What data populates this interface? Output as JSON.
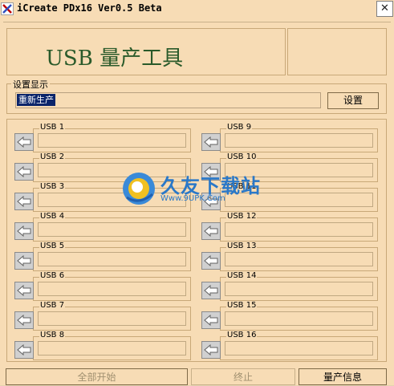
{
  "window": {
    "title": "iCreate PDx16 Ver0.5 Beta",
    "close_glyph": "✕"
  },
  "header": {
    "title": "USB 量产工具"
  },
  "settings": {
    "group_label": "设置显示",
    "value": "重新生产",
    "button_label": "设置"
  },
  "ports_left": [
    {
      "label": "USB 1"
    },
    {
      "label": "USB 2"
    },
    {
      "label": "USB 3"
    },
    {
      "label": "USB 4"
    },
    {
      "label": "USB 5"
    },
    {
      "label": "USB 6"
    },
    {
      "label": "USB 7"
    },
    {
      "label": "USB 8"
    }
  ],
  "ports_right": [
    {
      "label": "USB 9"
    },
    {
      "label": "USB 10"
    },
    {
      "label": "USB 11"
    },
    {
      "label": "USB 12"
    },
    {
      "label": "USB 13"
    },
    {
      "label": "USB 14"
    },
    {
      "label": "USB 15"
    },
    {
      "label": "USB 16"
    }
  ],
  "watermark": {
    "logo_text": "久友下载站",
    "url": "Www.9UPK.Com"
  },
  "footer": {
    "start_all": "全部开始",
    "stop": "终止",
    "info": "量产信息"
  },
  "colors": {
    "background": "#f7dcb5",
    "selection": "#0a246a",
    "header_text": "#2a5a2a",
    "watermark": "#2a78c8"
  }
}
